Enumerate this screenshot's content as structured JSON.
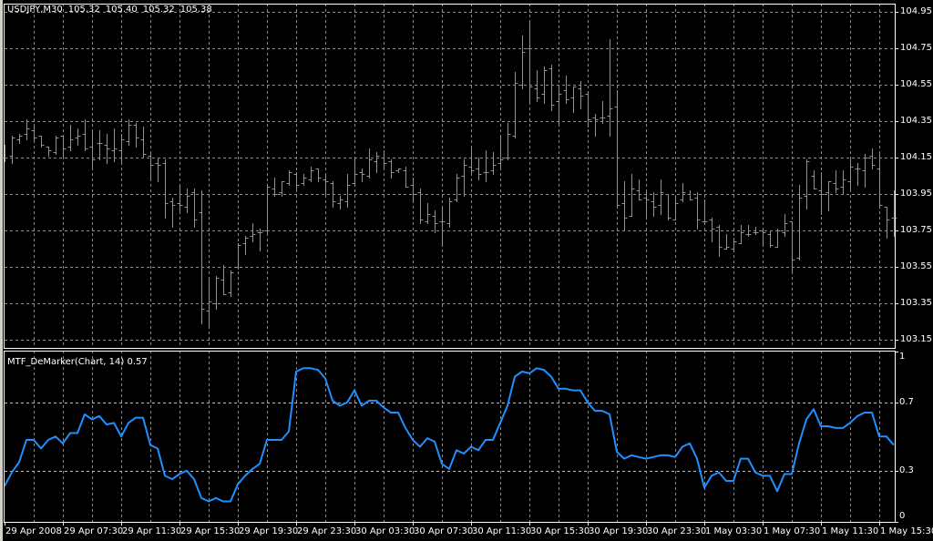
{
  "header": {
    "symbol": "USDJPY,M30",
    "open": "105.32",
    "high": "105.40",
    "low": "105.32",
    "close": "105.38"
  },
  "indicator": {
    "title": "MTF_DeMarker(Chart, 14) 0.57"
  },
  "colors": {
    "background": "#000000",
    "bars": "#22e022",
    "indicator_line": "#1e90ff",
    "grid": "#8090a0",
    "frame": "#ffffff"
  },
  "price_axis": [
    "104.95",
    "104.75",
    "104.55",
    "104.35",
    "104.15",
    "103.95",
    "103.75",
    "103.55",
    "103.35",
    "103.15"
  ],
  "indicator_axis": [
    "1",
    "0.7",
    "0.3",
    "0"
  ],
  "time_axis": [
    "29 Apr 2008",
    "29 Apr 07:30",
    "29 Apr 11:30",
    "29 Apr 15:30",
    "29 Apr 19:30",
    "29 Apr 23:30",
    "30 Apr 03:30",
    "30 Apr 07:30",
    "30 Apr 11:30",
    "30 Apr 15:30",
    "30 Apr 19:30",
    "30 Apr 23:30",
    "1 May 03:30",
    "1 May 07:30",
    "1 May 11:30",
    "1 May 15:30"
  ],
  "chart_data": {
    "type": "ohlc",
    "symbol": "USDJPY",
    "timeframe": "M30",
    "ylim": [
      103.15,
      104.95
    ],
    "ohlc": [
      [
        104.15,
        104.22,
        104.13,
        104.15
      ],
      [
        104.16,
        104.27,
        104.12,
        104.26
      ],
      [
        104.25,
        104.28,
        104.23,
        104.27
      ],
      [
        104.28,
        104.36,
        104.25,
        104.31
      ],
      [
        104.3,
        104.32,
        104.25,
        104.26
      ],
      [
        104.27,
        104.27,
        104.21,
        104.22
      ],
      [
        104.21,
        104.21,
        104.16,
        104.19
      ],
      [
        104.18,
        104.27,
        104.17,
        104.26
      ],
      [
        104.27,
        104.27,
        104.15,
        104.2
      ],
      [
        104.21,
        104.33,
        104.19,
        104.25
      ],
      [
        104.26,
        104.31,
        104.22,
        104.27
      ],
      [
        104.28,
        104.36,
        104.19,
        104.2
      ],
      [
        104.21,
        104.3,
        104.1,
        104.14
      ],
      [
        104.23,
        104.3,
        104.14,
        104.23
      ],
      [
        104.22,
        104.28,
        104.12,
        104.2
      ],
      [
        104.19,
        104.31,
        104.13,
        104.2
      ],
      [
        104.19,
        104.28,
        104.12,
        104.25
      ],
      [
        104.24,
        104.36,
        104.22,
        104.33
      ],
      [
        104.33,
        104.34,
        104.21,
        104.26
      ],
      [
        104.25,
        104.32,
        104.15,
        104.17
      ],
      [
        104.16,
        104.17,
        104.04,
        104.11
      ],
      [
        104.12,
        104.15,
        104.02,
        104.11
      ],
      [
        104.12,
        104.14,
        103.82,
        103.9
      ],
      [
        103.91,
        103.93,
        103.77,
        103.89
      ],
      [
        103.9,
        103.99,
        103.86,
        103.89
      ],
      [
        103.88,
        103.98,
        103.85,
        103.94
      ],
      [
        103.96,
        103.98,
        103.77,
        103.81
      ],
      [
        103.85,
        103.97,
        103.24,
        103.32
      ],
      [
        103.31,
        103.48,
        103.22,
        103.36
      ],
      [
        103.35,
        103.5,
        103.32,
        103.49
      ],
      [
        103.48,
        103.56,
        103.4,
        103.4
      ],
      [
        103.41,
        103.53,
        103.39,
        103.52
      ],
      [
        103.55,
        103.68,
        103.54,
        103.67
      ],
      [
        103.68,
        103.72,
        103.62,
        103.71
      ],
      [
        103.72,
        103.79,
        103.69,
        103.73
      ],
      [
        103.74,
        103.76,
        103.64,
        103.74
      ],
      [
        103.75,
        103.99,
        103.73,
        103.99
      ],
      [
        103.98,
        104.04,
        103.94,
        103.95
      ],
      [
        103.96,
        104.02,
        103.94,
        104.02
      ],
      [
        104.01,
        104.08,
        104.0,
        104.07
      ],
      [
        104.06,
        104.07,
        103.98,
        104.0
      ],
      [
        104.01,
        104.06,
        104.0,
        104.04
      ],
      [
        104.03,
        104.1,
        104.02,
        104.08
      ],
      [
        104.09,
        104.09,
        104.02,
        104.04
      ],
      [
        104.03,
        104.05,
        103.95,
        104.02
      ],
      [
        104.01,
        104.02,
        103.88,
        103.91
      ],
      [
        103.9,
        103.94,
        103.87,
        103.92
      ],
      [
        103.91,
        104.06,
        103.88,
        104.0
      ],
      [
        104.01,
        104.15,
        104.0,
        104.06
      ],
      [
        104.07,
        104.09,
        104.02,
        104.06
      ],
      [
        104.05,
        104.2,
        104.04,
        104.14
      ],
      [
        104.13,
        104.18,
        104.07,
        104.16
      ],
      [
        104.15,
        104.19,
        104.09,
        104.12
      ],
      [
        104.13,
        104.14,
        104.04,
        104.07
      ],
      [
        104.08,
        104.09,
        104.07,
        104.09
      ],
      [
        104.08,
        104.1,
        103.99,
        103.99
      ],
      [
        104.0,
        104.04,
        103.91,
        103.95
      ],
      [
        103.96,
        103.98,
        103.79,
        103.81
      ],
      [
        103.8,
        103.9,
        103.79,
        103.84
      ],
      [
        103.83,
        103.86,
        103.74,
        103.79
      ],
      [
        103.8,
        103.87,
        103.68,
        103.8
      ],
      [
        103.79,
        103.93,
        103.77,
        103.91
      ],
      [
        103.92,
        104.06,
        103.91,
        104.04
      ],
      [
        104.05,
        104.14,
        103.94,
        104.11
      ],
      [
        104.1,
        104.2,
        104.06,
        104.08
      ],
      [
        104.09,
        104.15,
        104.03,
        104.06
      ],
      [
        104.07,
        104.19,
        104.02,
        104.07
      ],
      [
        104.08,
        104.18,
        104.06,
        104.11
      ],
      [
        104.12,
        104.26,
        104.1,
        104.14
      ],
      [
        104.15,
        104.34,
        104.14,
        104.28
      ],
      [
        104.27,
        104.62,
        104.26,
        104.56
      ],
      [
        104.55,
        104.82,
        104.53,
        104.73
      ],
      [
        104.75,
        104.89,
        104.45,
        104.54
      ],
      [
        104.53,
        104.63,
        104.46,
        104.48
      ],
      [
        104.5,
        104.65,
        104.45,
        104.63
      ],
      [
        104.64,
        104.66,
        104.41,
        104.44
      ],
      [
        104.46,
        104.55,
        104.34,
        104.5
      ],
      [
        104.52,
        104.6,
        104.45,
        104.47
      ],
      [
        104.48,
        104.54,
        104.4,
        104.54
      ],
      [
        104.53,
        104.57,
        104.42,
        104.49
      ],
      [
        104.5,
        104.51,
        104.32,
        104.36
      ],
      [
        104.37,
        104.39,
        104.27,
        104.36
      ],
      [
        104.37,
        104.46,
        104.34,
        104.37
      ],
      [
        104.38,
        104.8,
        104.27,
        104.42
      ],
      [
        104.43,
        104.52,
        103.88,
        103.89
      ],
      [
        103.9,
        104.02,
        103.75,
        103.82
      ],
      [
        103.83,
        104.06,
        103.83,
        103.98
      ],
      [
        103.97,
        104.03,
        103.92,
        103.92
      ],
      [
        103.93,
        103.96,
        103.83,
        103.92
      ],
      [
        103.91,
        103.96,
        103.83,
        103.88
      ],
      [
        103.89,
        104.03,
        103.84,
        103.96
      ],
      [
        103.95,
        103.95,
        103.81,
        103.82
      ],
      [
        103.81,
        103.93,
        103.81,
        103.9
      ],
      [
        103.92,
        104.01,
        103.91,
        103.96
      ],
      [
        103.95,
        103.97,
        103.92,
        103.92
      ],
      [
        103.93,
        103.96,
        103.76,
        103.81
      ],
      [
        103.8,
        103.92,
        103.8,
        103.8
      ],
      [
        103.81,
        103.82,
        103.69,
        103.76
      ],
      [
        103.77,
        103.78,
        103.61,
        103.66
      ],
      [
        103.65,
        103.73,
        103.65,
        103.66
      ],
      [
        103.65,
        103.71,
        103.64,
        103.69
      ],
      [
        103.68,
        103.78,
        103.68,
        103.74
      ],
      [
        103.73,
        103.78,
        103.72,
        103.73
      ],
      [
        103.74,
        103.77,
        103.73,
        103.74
      ],
      [
        103.75,
        103.75,
        103.67,
        103.74
      ],
      [
        103.73,
        103.75,
        103.66,
        103.67
      ],
      [
        103.66,
        103.76,
        103.66,
        103.75
      ],
      [
        103.74,
        103.84,
        103.72,
        103.79
      ],
      [
        103.8,
        103.8,
        103.53,
        103.59
      ],
      [
        103.6,
        104.0,
        103.59,
        103.93
      ],
      [
        103.94,
        104.14,
        103.87,
        104.13
      ],
      [
        104.05,
        104.08,
        103.98,
        103.98
      ],
      [
        103.97,
        104.07,
        103.84,
        103.95
      ],
      [
        103.96,
        104.02,
        103.86,
        104.02
      ],
      [
        104.01,
        104.08,
        103.96,
        103.98
      ],
      [
        103.99,
        104.08,
        103.95,
        104.03
      ],
      [
        104.02,
        104.14,
        103.97,
        104.1
      ],
      [
        104.09,
        104.12,
        104.0,
        104.09
      ],
      [
        104.08,
        104.17,
        103.99,
        104.15
      ],
      [
        104.16,
        104.2,
        104.09,
        104.11
      ],
      [
        104.09,
        104.17,
        103.89,
        103.89
      ],
      [
        103.88,
        103.88,
        103.71,
        103.81
      ],
      [
        103.82,
        103.97,
        103.72,
        103.82
      ]
    ],
    "indicator": {
      "name": "MTF_DeMarker(Chart, 14)",
      "ylim": [
        0,
        1
      ],
      "levels": [
        0.3,
        0.7
      ],
      "values": [
        0.21,
        0.29,
        0.35,
        0.48,
        0.48,
        0.43,
        0.48,
        0.5,
        0.46,
        0.52,
        0.52,
        0.63,
        0.6,
        0.62,
        0.57,
        0.58,
        0.5,
        0.58,
        0.61,
        0.61,
        0.45,
        0.43,
        0.27,
        0.25,
        0.28,
        0.3,
        0.25,
        0.14,
        0.12,
        0.14,
        0.12,
        0.12,
        0.22,
        0.27,
        0.31,
        0.34,
        0.48,
        0.48,
        0.48,
        0.53,
        0.88,
        0.9,
        0.9,
        0.89,
        0.84,
        0.71,
        0.68,
        0.7,
        0.77,
        0.68,
        0.71,
        0.71,
        0.67,
        0.64,
        0.64,
        0.55,
        0.48,
        0.44,
        0.49,
        0.47,
        0.34,
        0.31,
        0.42,
        0.4,
        0.44,
        0.42,
        0.48,
        0.48,
        0.58,
        0.68,
        0.85,
        0.88,
        0.87,
        0.9,
        0.89,
        0.85,
        0.78,
        0.78,
        0.77,
        0.77,
        0.7,
        0.65,
        0.65,
        0.63,
        0.41,
        0.37,
        0.39,
        0.38,
        0.37,
        0.38,
        0.39,
        0.39,
        0.38,
        0.44,
        0.46,
        0.37,
        0.2,
        0.27,
        0.29,
        0.24,
        0.24,
        0.37,
        0.37,
        0.29,
        0.27,
        0.27,
        0.18,
        0.28,
        0.28,
        0.46,
        0.6,
        0.66,
        0.56,
        0.56,
        0.55,
        0.55,
        0.58,
        0.62,
        0.64,
        0.64,
        0.5,
        0.5,
        0.45
      ]
    }
  }
}
